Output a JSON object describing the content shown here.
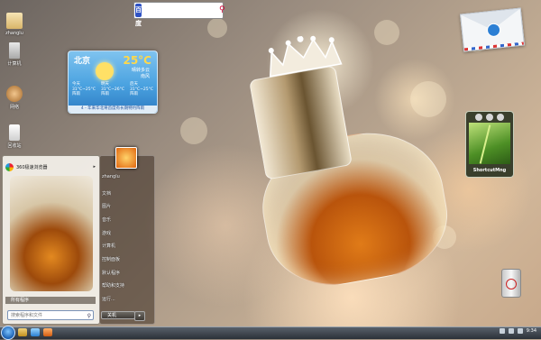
{
  "search": {
    "logo": "百度",
    "placeholder": "",
    "button": "⚲"
  },
  "desktop_icons": [
    {
      "label": "zhanglu",
      "icon": "user-folder-icon"
    },
    {
      "label": "计算机",
      "icon": "computer-icon"
    },
    {
      "label": "网络",
      "icon": "network-icon"
    },
    {
      "label": "回收站",
      "icon": "recycle-bin-icon"
    }
  ],
  "weather": {
    "city": "北京",
    "temp": "25°C",
    "condition_line1": "晴转多云",
    "condition_line2": "南风",
    "days": [
      {
        "name": "今天",
        "range": "31°C~25°C",
        "cond": "阵雨"
      },
      {
        "name": "明天",
        "range": "31°C~26°C",
        "cond": "阵雨"
      },
      {
        "name": "后天",
        "range": "31°C~25°C",
        "cond": "阵雨"
      }
    ],
    "footer": "4 - 年来华北将首度有长期特约阵雨"
  },
  "shortcut_widget": {
    "label": "ShortcutMng"
  },
  "start_menu": {
    "pinned_app": "360极速浏览器",
    "all_programs": "所有程序",
    "search_placeholder": "搜索程序和文件",
    "user_name": "zhanglu",
    "right_items": [
      "zhanglu",
      "文档",
      "图片",
      "音乐",
      "游戏",
      "计算机",
      "控制面板",
      "默认程序",
      "帮助和支持",
      "运行..."
    ],
    "shutdown": "关机",
    "shutdown_arrow": "▸"
  },
  "taskbar": {
    "clock": "9:34"
  }
}
